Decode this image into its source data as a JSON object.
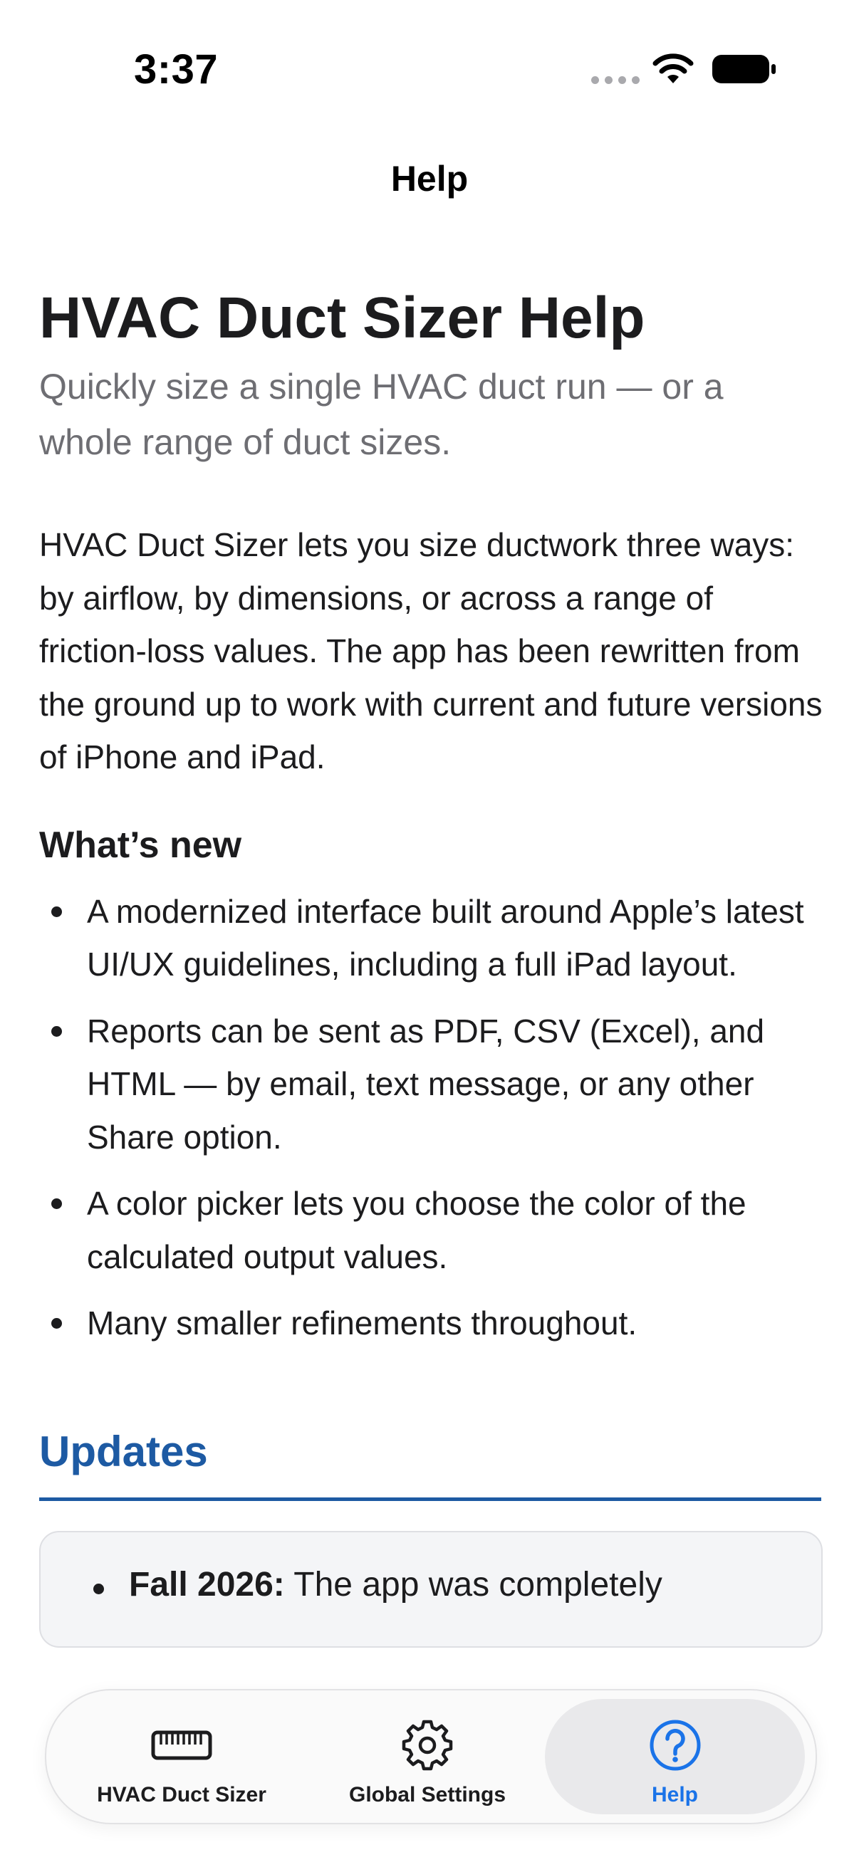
{
  "status_bar": {
    "time": "3:37"
  },
  "nav": {
    "title": "Help"
  },
  "content": {
    "title": "HVAC Duct Sizer Help",
    "subtitle": "Quickly size a single HVAC duct run — or a whole range of duct sizes.",
    "intro": "HVAC Duct Sizer lets you size ductwork three ways: by airflow, by dimensions, or across a range of friction-loss values. The app has been rewritten from the ground up to work with current and future versions of iPhone and iPad.",
    "whats_new_heading": "What’s new",
    "whats_new_items": [
      "A modernized interface built around Apple’s latest UI/UX guidelines, including a full iPad layout.",
      "Reports can be sent as PDF, CSV (Excel), and HTML — by email, text message, or any other Share option.",
      "A color picker lets you choose the color of the calculated output values.",
      "Many smaller refinements throughout."
    ],
    "updates_heading": "Updates",
    "updates_items": [
      {
        "label": "Fall 2026:",
        "text": " The app was completely"
      }
    ]
  },
  "tab_bar": {
    "tabs": [
      {
        "label": "HVAC Duct Sizer",
        "icon": "ruler-icon",
        "selected": false
      },
      {
        "label": "Global Settings",
        "icon": "gear-icon",
        "selected": false
      },
      {
        "label": "Help",
        "icon": "question-circle-icon",
        "selected": true
      }
    ]
  },
  "colors": {
    "accent": "#1a73e8",
    "updates_heading": "#1d5aa3",
    "subtitle": "#6e6e73"
  }
}
